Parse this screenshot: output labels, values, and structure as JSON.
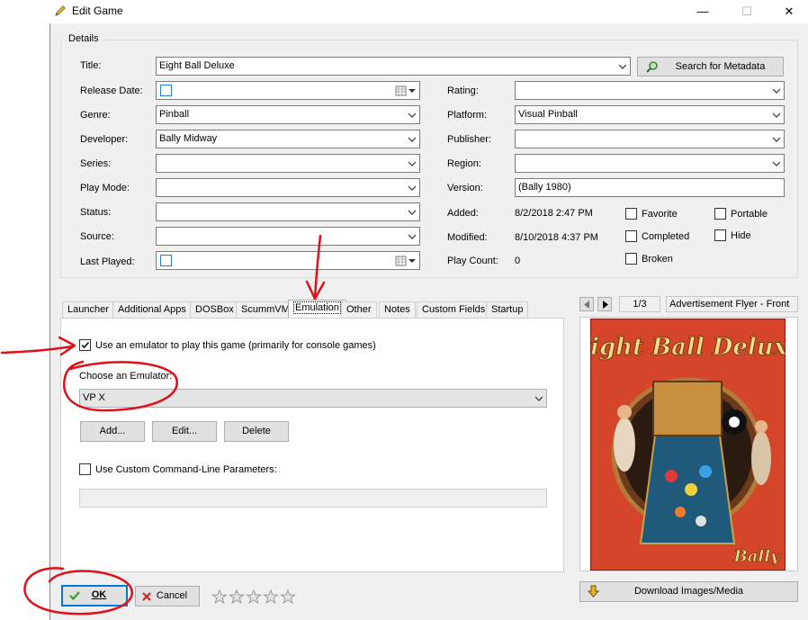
{
  "window": {
    "title": "Edit Game",
    "minimize": "—",
    "maximize": "☐",
    "close": "✕"
  },
  "details": {
    "group_label": "Details",
    "labels": {
      "title": "Title:",
      "release_date": "Release Date:",
      "genre": "Genre:",
      "developer": "Developer:",
      "series": "Series:",
      "play_mode": "Play Mode:",
      "status": "Status:",
      "source": "Source:",
      "last_played": "Last Played:",
      "rating": "Rating:",
      "platform": "Platform:",
      "publisher": "Publisher:",
      "region": "Region:",
      "version": "Version:",
      "added": "Added:",
      "modified": "Modified:",
      "play_count": "Play Count:"
    },
    "values": {
      "title": "Eight Ball Deluxe",
      "release_date": "",
      "genre": "Pinball",
      "developer": "Bally Midway",
      "series": "",
      "play_mode": "",
      "status": "",
      "source": "",
      "last_played": "",
      "rating": "",
      "platform": "Visual Pinball",
      "publisher": "",
      "region": "",
      "version": "(Bally 1980)",
      "added": "8/2/2018 2:47 PM",
      "modified": "8/10/2018 4:37 PM",
      "play_count": "0"
    },
    "search_metadata": "Search for Metadata",
    "checks": {
      "favorite": "Favorite",
      "portable": "Portable",
      "completed": "Completed",
      "hide": "Hide",
      "broken": "Broken"
    }
  },
  "tabs": [
    "Launcher",
    "Additional Apps",
    "DOSBox",
    "ScummVM",
    "Emulation",
    "Other",
    "Notes",
    "Custom Fields",
    "Startup"
  ],
  "emulation": {
    "use_emulator_label": "Use an emulator to play this game (primarily for console games)",
    "use_emulator_checked": true,
    "choose_label": "Choose an Emulator:",
    "selected_emulator": "VP X",
    "add": "Add...",
    "edit": "Edit...",
    "delete": "Delete",
    "custom_cmd_label": "Use Custom Command-Line Parameters:",
    "custom_cmd_value": ""
  },
  "image_panel": {
    "counter": "1/3",
    "image_type": "Advertisement Flyer - Front",
    "download_button": "Download Images/Media",
    "flyer_title": "Eight Ball Deluxe",
    "flyer_brand": "Bally"
  },
  "footer": {
    "ok": "OK",
    "cancel": "Cancel",
    "rating_stars": 5,
    "rating_value": 0
  },
  "colors": {
    "annotation_red": "#e0101a",
    "focus_blue": "#0078d7",
    "ok_check": "#2fa12f"
  }
}
